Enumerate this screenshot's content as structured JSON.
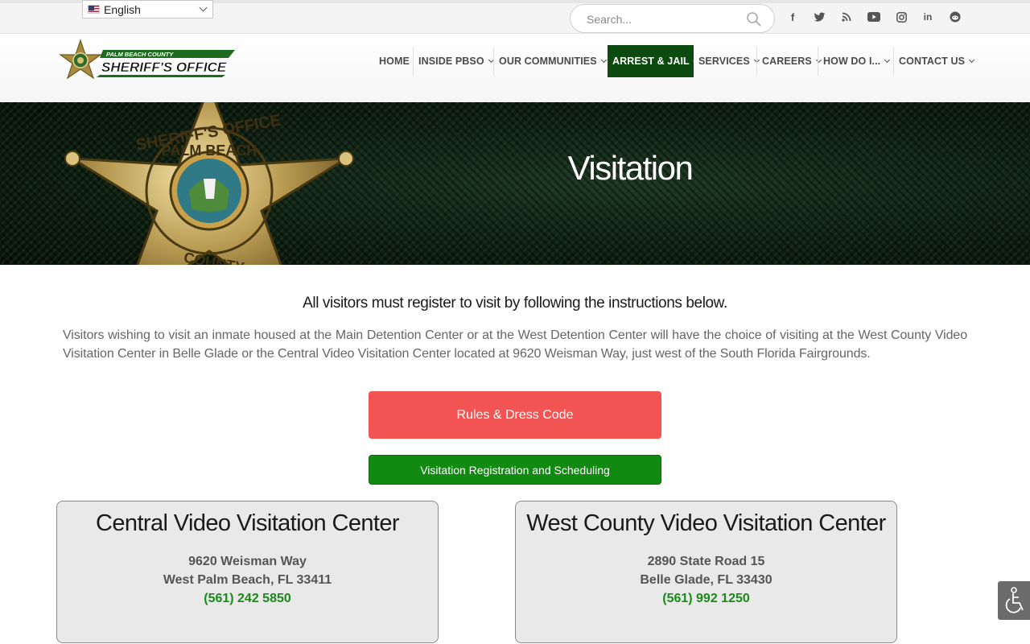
{
  "topbar": {
    "language": "English",
    "search_placeholder": "Search...",
    "social_icons": [
      "facebook-icon",
      "twitter-icon",
      "rss-icon",
      "youtube-icon",
      "instagram-icon",
      "linkedin-icon",
      "reddit-icon"
    ]
  },
  "logo": {
    "line1": "PALM BEACH COUNTY",
    "line2": "SHERIFF'S OFFICE"
  },
  "nav": {
    "items": [
      {
        "label": "HOME"
      },
      {
        "label": "INSIDE PBSO"
      },
      {
        "label": "OUR COMMUNITIES"
      },
      {
        "label": "ARREST & JAIL"
      },
      {
        "label": "SERVICES"
      },
      {
        "label": "CAREERS"
      },
      {
        "label": "HOW DO I..."
      },
      {
        "label": "CONTACT US"
      }
    ],
    "active_color": "#0d4a0f"
  },
  "hero": {
    "title": "Visitation",
    "badge_text": "SHERIFF'S OFFICE · PALM BEACH · COUNTY"
  },
  "content": {
    "lead": "All visitors must register to visit by following the instructions below.",
    "paragraph": "Visitors wishing to visit an inmate housed at the Main Detention Center or at the West Detention Center will have the choice of visiting at the West County Video Visitation Center in Belle Glade or the Central Video Visitation Center located at 9620 Weisman Way,  just west of the South Florida Fairgrounds.",
    "rules_button": "Rules & Dress Code",
    "register_button": "Visitation Registration and Scheduling"
  },
  "centers": [
    {
      "name": "Central Video Visitation Center",
      "street": "9620 Weisman Way",
      "city": "West Palm Beach, FL 33411",
      "phone": "(561) 242 5850"
    },
    {
      "name": "West County Video Visitation Center",
      "street": "2890 State Road 15",
      "city": "Belle Glade, FL 33430",
      "phone": "(561) 992 1250"
    }
  ],
  "colors": {
    "red_button": "#f25454",
    "green_button": "#128a12",
    "phone_green": "#1a8a1a"
  }
}
